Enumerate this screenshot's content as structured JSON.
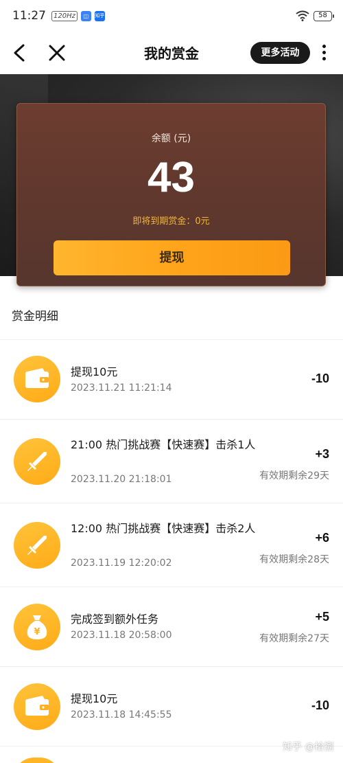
{
  "status_bar": {
    "time": "11:27",
    "chip": "120Hz",
    "app1": "◫",
    "app2": "知乎",
    "battery": "58"
  },
  "nav": {
    "title": "我的赏金",
    "more_label": "更多活动",
    "back_icon": "back-arrow-icon",
    "close_icon": "close-icon"
  },
  "balance": {
    "label": "余额 (元)",
    "value": "43",
    "expire_text": "即将到期赏金：0元",
    "withdraw_label": "提现"
  },
  "colors": {
    "accent": "#ffa51b",
    "card": "#5e372d",
    "expire": "#f0b73a"
  },
  "section": {
    "title": "赏金明细"
  },
  "records": [
    {
      "icon": "wallet-icon",
      "title": "提现10元",
      "time": "2023.11.21 11:21:14",
      "amount": "-10",
      "validity": ""
    },
    {
      "icon": "sword-icon",
      "title": "21:00 热门挑战赛【快速赛】击杀1人",
      "time": "2023.11.20 21:18:01",
      "amount": "+3",
      "validity": "有效期剩余29天"
    },
    {
      "icon": "sword-icon",
      "title": "12:00 热门挑战赛【快速赛】击杀2人",
      "time": "2023.11.19 12:20:02",
      "amount": "+6",
      "validity": "有效期剩余28天"
    },
    {
      "icon": "money-bag-icon",
      "title": "完成签到额外任务",
      "time": "2023.11.18 20:58:00",
      "amount": "+5",
      "validity": "有效期剩余27天"
    },
    {
      "icon": "wallet-icon",
      "title": "提现10元",
      "time": "2023.11.18 14:45:55",
      "amount": "-10",
      "validity": ""
    }
  ],
  "watermark": "知乎 @拾捌"
}
